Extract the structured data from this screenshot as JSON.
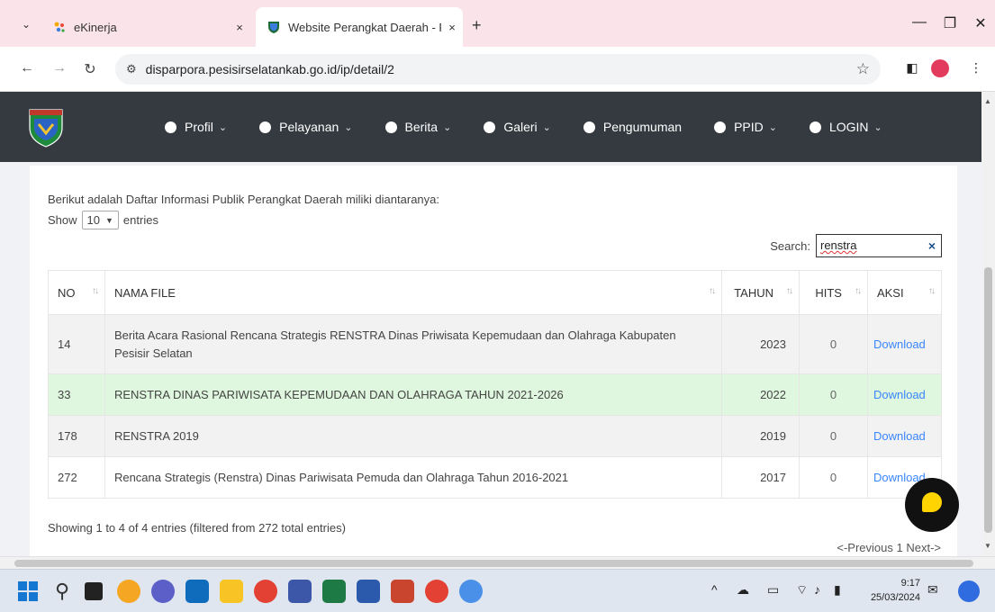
{
  "browser": {
    "tabs": [
      {
        "title": "eKinerja",
        "close": "×"
      },
      {
        "title": "Website Perangkat Daerah - Pe",
        "close": "×"
      }
    ],
    "new_tab": "+",
    "url": "disparpora.pesisirselatankab.go.id/ip/detail/2",
    "window_controls": {
      "minimize": "—",
      "restore": "❐",
      "close": "✕"
    }
  },
  "site": {
    "menu": [
      {
        "label": "Profil",
        "dropdown": true
      },
      {
        "label": "Pelayanan",
        "dropdown": true
      },
      {
        "label": "Berita",
        "dropdown": true
      },
      {
        "label": "Galeri",
        "dropdown": true
      },
      {
        "label": "Pengumuman",
        "dropdown": false
      },
      {
        "label": "PPID",
        "dropdown": true
      },
      {
        "label": "LOGIN",
        "dropdown": true
      }
    ]
  },
  "content": {
    "intro": "Berikut adalah Daftar Informasi Publik Perangkat Daerah miliki diantaranya:",
    "show_label": "Show",
    "entries_value": "10",
    "entries_label": "entries",
    "search_label": "Search:",
    "search_value": "renstra",
    "table": {
      "headers": [
        "NO",
        "NAMA FILE",
        "TAHUN",
        "HITS",
        "AKSI"
      ],
      "rows": [
        {
          "no": "14",
          "nama": "Berita Acara Rasional Rencana Strategis RENSTRA Dinas Priwisata Kepemudaan dan Olahraga Kabupaten Pesisir Selatan",
          "tahun": "2023",
          "hits": "0",
          "aksi": "Download"
        },
        {
          "no": "33",
          "nama": "RENSTRA DINAS PARIWISATA KEPEMUDAAN DAN OLAHRAGA TAHUN 2021-2026",
          "tahun": "2022",
          "hits": "0",
          "aksi": "Download"
        },
        {
          "no": "178",
          "nama": "RENSTRA 2019",
          "tahun": "2019",
          "hits": "0",
          "aksi": "Download"
        },
        {
          "no": "272",
          "nama": "Rencana Strategis (Renstra) Dinas Pariwisata Pemuda dan Olahraga Tahun 2016-2021",
          "tahun": "2017",
          "hits": "0",
          "aksi": "Download"
        }
      ]
    },
    "info": "Showing 1 to 4 of 4 entries (filtered from 272 total entries)",
    "pager": "<-Previous 1 Next->"
  },
  "taskbar": {
    "time": "9:17",
    "date": "25/03/2024"
  },
  "colors": {
    "nav_bg": "#343a40",
    "highlight_row": "#dff7df",
    "link": "#3a86ff",
    "tab_strip": "#fbe3ea"
  }
}
